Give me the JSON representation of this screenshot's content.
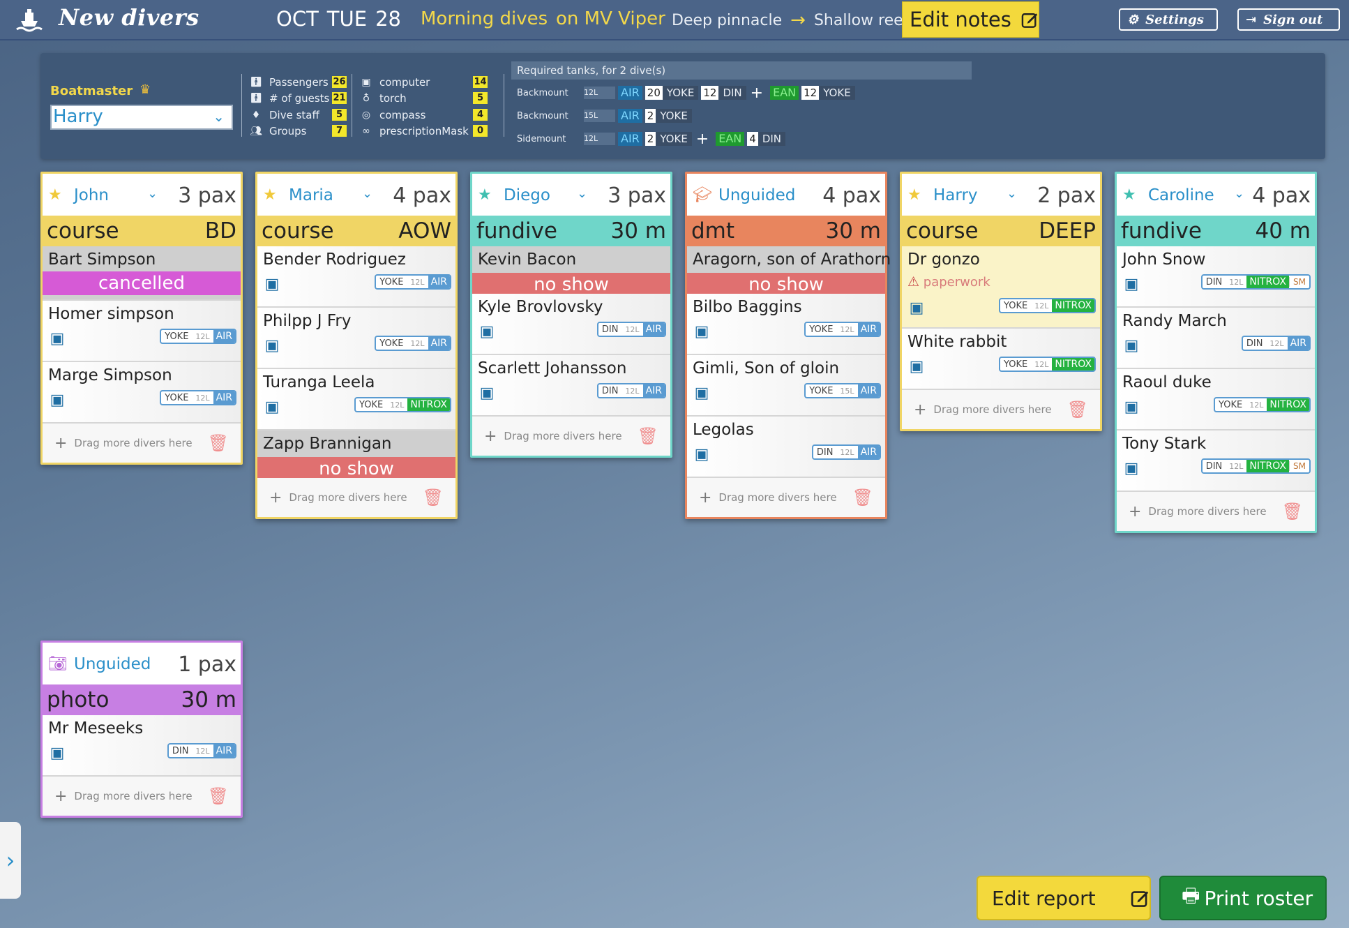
{
  "header": {
    "brand": "New divers",
    "month": "OCT",
    "weekday": "TUE",
    "day": "28",
    "session": "Morning dives",
    "boat": "on MV Viper",
    "route_from": "Deep pinnacle",
    "route_to": "Shallow reef",
    "edit_notes": "Edit notes",
    "settings": "Settings",
    "sign_out": "Sign out"
  },
  "summary": {
    "boatmaster_label": "Boatmaster",
    "boatmaster": "Harry",
    "stats_left": [
      {
        "icon": "person-icon",
        "label": "Passengers",
        "value": "26"
      },
      {
        "icon": "person-icon",
        "label": "# of guests",
        "value": "21"
      },
      {
        "icon": "badge-icon",
        "label": "Dive staff",
        "value": "5"
      },
      {
        "icon": "group-icon",
        "label": "Groups",
        "value": "7"
      }
    ],
    "stats_right": [
      {
        "icon": "computer-icon",
        "label": "computer",
        "value": "14"
      },
      {
        "icon": "torch-icon",
        "label": "torch",
        "value": "5"
      },
      {
        "icon": "compass-icon",
        "label": "compass",
        "value": "4"
      },
      {
        "icon": "mask-icon",
        "label": "prescriptionMask",
        "value": "0"
      }
    ],
    "tanks_header": "Required tanks, for 2 dive(s)",
    "tank_rows": [
      {
        "name": "Backmount",
        "size": "12L",
        "gas1": "AIR",
        "c1": "20",
        "v1": "YOKE",
        "c2": "12",
        "v2": "DIN",
        "gas2": "EAN",
        "c3": "12",
        "v3": "YOKE"
      },
      {
        "name": "Backmount",
        "size": "15L",
        "gas1": "AIR",
        "c1": "2",
        "v1": "YOKE"
      },
      {
        "name": "Sidemount",
        "size": "12L",
        "gas1": "AIR",
        "c1": "2",
        "v1": "YOKE",
        "gas2": "EAN",
        "c3": "4",
        "v3": "DIN"
      }
    ]
  },
  "groups": [
    {
      "guide": "John",
      "pax": "3 pax",
      "type": "course",
      "detail": "BD",
      "divers": [
        {
          "name": "Bart Simpson",
          "status": "cancelled"
        },
        {
          "name": "Homer simpson",
          "valve": "YOKE",
          "size": "12L",
          "gas": "AIR"
        },
        {
          "name": "Marge Simpson",
          "valve": "YOKE",
          "size": "12L",
          "gas": "AIR"
        }
      ]
    },
    {
      "guide": "Maria",
      "pax": "4 pax",
      "type": "course",
      "detail": "AOW",
      "divers": [
        {
          "name": "Bender Rodriguez",
          "valve": "YOKE",
          "size": "12L",
          "gas": "AIR"
        },
        {
          "name": "Philpp J Fry",
          "valve": "YOKE",
          "size": "12L",
          "gas": "AIR"
        },
        {
          "name": "Turanga Leela",
          "valve": "YOKE",
          "size": "12L",
          "gas": "NITROX"
        },
        {
          "name": "Zapp Brannigan",
          "status": "no show"
        }
      ]
    },
    {
      "guide": "Diego",
      "pax": "3 pax",
      "type": "fundive",
      "detail": "30 m",
      "divers": [
        {
          "name": "Kevin Bacon",
          "status": "no show"
        },
        {
          "name": "Kyle Brovlovsky",
          "valve": "DIN",
          "size": "12L",
          "gas": "AIR"
        },
        {
          "name": "Scarlett Johansson",
          "valve": "DIN",
          "size": "12L",
          "gas": "AIR"
        }
      ]
    },
    {
      "guide": "Unguided",
      "pax": "4 pax",
      "type": "dmt",
      "detail": "30 m",
      "divers": [
        {
          "name": "Aragorn, son of Arathorn",
          "status": "no show"
        },
        {
          "name": "Bilbo Baggins",
          "valve": "YOKE",
          "size": "12L",
          "gas": "AIR"
        },
        {
          "name": "Gimli, Son of gloin",
          "valve": "YOKE",
          "size": "15L",
          "gas": "AIR"
        },
        {
          "name": "Legolas",
          "valve": "DIN",
          "size": "12L",
          "gas": "AIR"
        }
      ]
    },
    {
      "guide": "Harry",
      "pax": "2 pax",
      "type": "course",
      "detail": "DEEP",
      "divers": [
        {
          "name": "Dr gonzo",
          "warning": "paperwork",
          "valve": "YOKE",
          "size": "12L",
          "gas": "NITROX"
        },
        {
          "name": "White rabbit",
          "valve": "YOKE",
          "size": "12L",
          "gas": "NITROX"
        }
      ]
    },
    {
      "guide": "Caroline",
      "pax": "4 pax",
      "type": "fundive",
      "detail": "40 m",
      "divers": [
        {
          "name": "John Snow",
          "valve": "DIN",
          "size": "12L",
          "gas": "NITROX",
          "extra": "SM"
        },
        {
          "name": "Randy March",
          "valve": "DIN",
          "size": "12L",
          "gas": "AIR"
        },
        {
          "name": "Raoul duke",
          "valve": "YOKE",
          "size": "12L",
          "gas": "NITROX"
        },
        {
          "name": "Tony Stark",
          "valve": "DIN",
          "size": "12L",
          "gas": "NITROX",
          "extra": "SM"
        }
      ]
    },
    {
      "guide": "Unguided",
      "pax": "1 pax",
      "type": "photo",
      "detail": "30 m",
      "divers": [
        {
          "name": "Mr Meseeks",
          "valve": "DIN",
          "size": "12L",
          "gas": "AIR"
        }
      ]
    }
  ],
  "drag_hint": "Drag more divers here",
  "footer": {
    "edit_report": "Edit report",
    "print_roster": "Print roster"
  },
  "colors": {
    "course": "#f0d565",
    "fundive": "#6fd6c9",
    "dmt": "#e8855e",
    "photo": "#c77fe3",
    "cancelled": "#d65ad6",
    "noshow": "#e07070"
  }
}
